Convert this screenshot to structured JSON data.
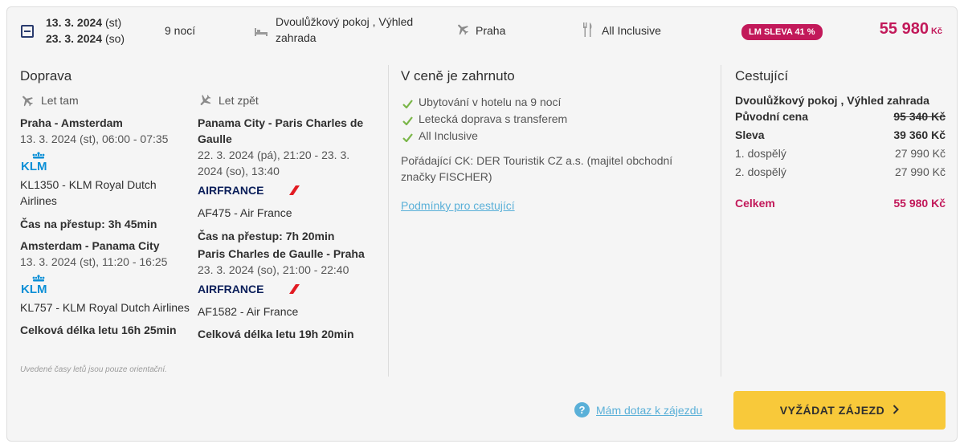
{
  "header": {
    "date_from": "13. 3. 2024",
    "day_from": "(st)",
    "date_to": "23. 3. 2024",
    "day_to": "(so)",
    "nights": "9 nocí",
    "room": "Dvoulůžkový pokoj , Výhled zahrada",
    "origin": "Praha",
    "board": "All Inclusive",
    "discount_badge": "LM SLEVA 41 %",
    "price": "55 980",
    "currency": "Kč"
  },
  "transport": {
    "title": "Doprava",
    "outbound": {
      "label": "Let tam",
      "leg1_route": "Praha - Amsterdam",
      "leg1_time": "13. 3. 2024 (st), 06:00 - 07:35",
      "leg1_airline_logo": "KLM",
      "leg1_flight": "KL1350 - KLM Royal Dutch Airlines",
      "transfer": "Čas na přestup: 3h 45min",
      "leg2_route": "Amsterdam - Panama City",
      "leg2_time": "13. 3. 2024 (st), 11:20 - 16:25",
      "leg2_airline_logo": "KLM",
      "leg2_flight": "KL757 - KLM Royal Dutch Airlines",
      "total": "Celková délka letu 16h 25min"
    },
    "return": {
      "label": "Let zpět",
      "leg1_route": "Panama City - Paris Charles de Gaulle",
      "leg1_time": "22. 3. 2024 (pá), 21:20 - 23. 3. 2024 (so), 13:40",
      "leg1_airline_logo": "AIRFRANCE",
      "leg1_flight": "AF475 - Air France",
      "transfer": "Čas na přestup: 7h 20min",
      "leg2_route": "Paris Charles de Gaulle - Praha",
      "leg2_time": "23. 3. 2024 (so), 21:00 - 22:40",
      "leg2_airline_logo": "AIRFRANCE",
      "leg2_flight": "AF1582 - Air France",
      "total": "Celková délka letu 19h 20min"
    },
    "note": "Uvedené časy letů jsou pouze orientační."
  },
  "included": {
    "title": "V ceně je zahrnuto",
    "items": [
      "Ubytování v hotelu na 9 nocí",
      "Letecká doprava s transferem",
      "All Inclusive"
    ],
    "organizer": "Pořádající CK: DER Touristik CZ a.s. (majitel obchodní značky FISCHER)",
    "conditions_link": "Podmínky pro cestující"
  },
  "travelers": {
    "title": "Cestující",
    "room": "Dvoulůžkový pokoj , Výhled zahrada",
    "original_label": "Původní cena",
    "original_value": "95 340 Kč",
    "discount_label": "Sleva",
    "discount_value": "39 360 Kč",
    "adult1_label": "1. dospělý",
    "adult1_value": "27 990 Kč",
    "adult2_label": "2. dospělý",
    "adult2_value": "27 990 Kč",
    "total_label": "Celkem",
    "total_value": "55 980 Kč"
  },
  "footer": {
    "question_icon": "?",
    "question_link": "Mám dotaz k zájezdu",
    "cta": "VYŽÁDAT ZÁJEZD"
  },
  "colors": {
    "accent": "#c2195a",
    "link": "#5ab0d8",
    "cta": "#f8c93a",
    "check": "#7ab648",
    "klm": "#0a8fd6",
    "airfrance_navy": "#0b1f5a",
    "airfrance_red": "#e21b23"
  }
}
